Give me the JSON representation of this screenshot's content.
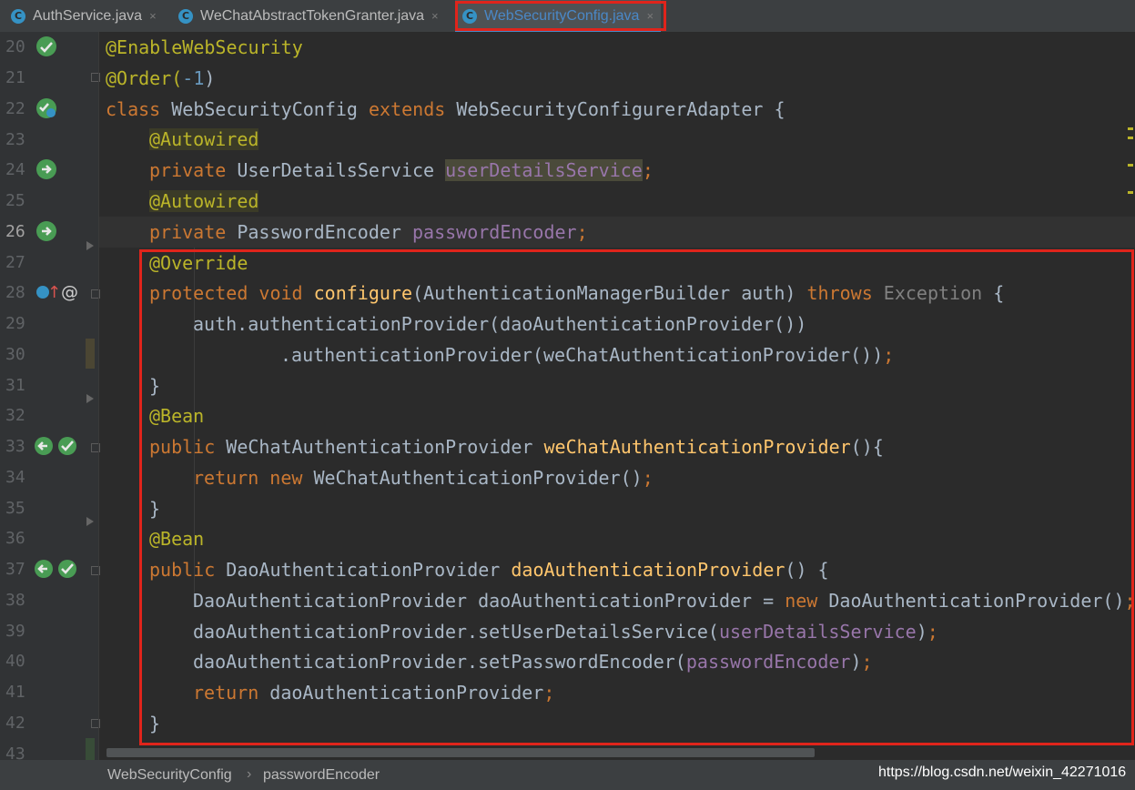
{
  "tabs": [
    {
      "label": "AuthService.java",
      "icon": "class-c-icon",
      "active": false
    },
    {
      "label": "WeChatAbstractTokenGranter.java",
      "icon": "class-c-icon",
      "active": false
    },
    {
      "label": "WebSecurityConfig.java",
      "icon": "class-c-icon",
      "active": true
    }
  ],
  "tab_icon_letter": "C",
  "tab_close_glyph": "×",
  "line_numbers": [
    "20",
    "21",
    "22",
    "23",
    "24",
    "25",
    "26",
    "27",
    "28",
    "29",
    "30",
    "31",
    "32",
    "33",
    "34",
    "35",
    "36",
    "37",
    "38",
    "39",
    "40",
    "41",
    "42",
    "43"
  ],
  "current_line": "26",
  "code": {
    "l20": {
      "a": "@EnableWebSecurity"
    },
    "l21": {
      "a": "@Order(",
      "b": "-1",
      "c": ")"
    },
    "l22": {
      "a": "class ",
      "b": "WebSecurityConfig ",
      "c": "extends ",
      "d": "WebSecurityConfigurerAdapter {"
    },
    "l23": {
      "a": "@Autowired"
    },
    "l24": {
      "a": "private ",
      "b": "UserDetailsService ",
      "c": "userDetailsService",
      "d": ";"
    },
    "l25": {
      "a": "@Autowired"
    },
    "l26": {
      "a": "private ",
      "b": "PasswordEncoder ",
      "c": "passwordEncoder",
      "d": ";"
    },
    "l27": {
      "a": "@Override"
    },
    "l28": {
      "a": "protected void ",
      "b": "configure",
      "c": "(AuthenticationManagerBuilder auth) ",
      "d": "throws ",
      "e": "Exception",
      "f": " {"
    },
    "l29": {
      "a": "auth.authenticationProvider(daoAuthenticationProvider())"
    },
    "l30": {
      "a": ".authenticationProvider(weChatAuthenticationProvider())",
      "b": ";"
    },
    "l31": {
      "a": "}"
    },
    "l32": {
      "a": "@Bean"
    },
    "l33": {
      "a": "public ",
      "b": "WeChatAuthenticationProvider ",
      "c": "weChatAuthenticationProvider",
      "d": "(){"
    },
    "l34": {
      "a": "return new ",
      "b": "WeChatAuthenticationProvider()",
      "c": ";"
    },
    "l35": {
      "a": "}"
    },
    "l36": {
      "a": "@Bean"
    },
    "l37": {
      "a": "public ",
      "b": "DaoAuthenticationProvider ",
      "c": "daoAuthenticationProvider",
      "d": "() {"
    },
    "l38": {
      "a": "DaoAuthenticationProvider daoAuthenticationProvider = ",
      "b": "new ",
      "c": "DaoAuthenticationProvider()",
      "d": ";"
    },
    "l39": {
      "a": "daoAuthenticationProvider.setUserDetailsService(",
      "b": "userDetailsService",
      "c": ")",
      "d": ";"
    },
    "l40": {
      "a": "daoAuthenticationProvider.setPasswordEncoder(",
      "b": "passwordEncoder",
      "c": ")",
      "d": ";"
    },
    "l41": {
      "a": "return ",
      "b": "daoAuthenticationProvider",
      "c": ";"
    },
    "l42": {
      "a": "}"
    }
  },
  "gutter_at_glyph": "@",
  "gutter_up_glyph": "↑",
  "breadcrumb": {
    "class": "WebSecurityConfig",
    "separator": "›",
    "member": "passwordEncoder"
  },
  "watermark": "https://blog.csdn.net/weixin_42271016",
  "colors": {
    "keyword": "#cc7832",
    "annotation": "#bbb529",
    "method": "#ffc66d",
    "field": "#9876aa",
    "number": "#6897bb",
    "highlight_box": "#e0241b"
  }
}
